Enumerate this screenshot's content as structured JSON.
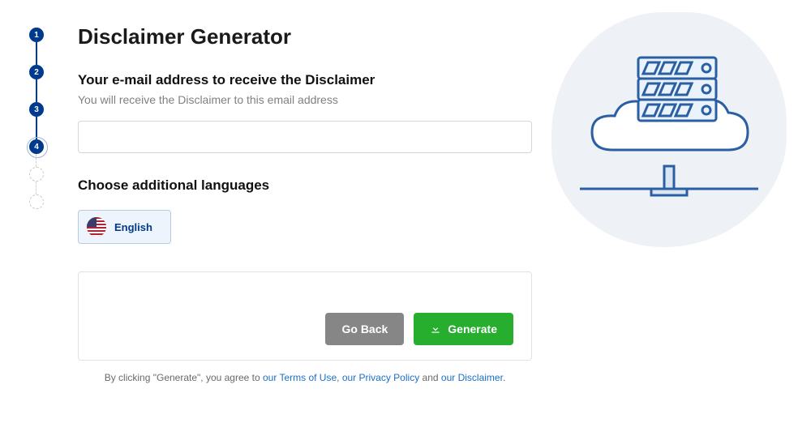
{
  "title": "Disclaimer Generator",
  "stepper": {
    "steps": [
      "1",
      "2",
      "3",
      "4"
    ],
    "current": 4,
    "extra_dashed": 2
  },
  "email_section": {
    "heading": "Your e-mail address to receive the Disclaimer",
    "hint": "You will receive the Disclaimer to this email address",
    "value": ""
  },
  "lang_section": {
    "heading": "Choose additional languages",
    "selected": "English"
  },
  "buttons": {
    "back": "Go Back",
    "generate": "Generate"
  },
  "footer": {
    "prefix": "By clicking \"Generate\", you agree to ",
    "terms": "our Terms of Use",
    "sep1": ", ",
    "privacy": "our Privacy Policy",
    "sep2": " and ",
    "disclaimer": "our Disclaimer",
    "suffix": "."
  },
  "icons": {
    "flag": "usa-flag-icon",
    "download": "download-icon",
    "illustration": "cloud-server-illustration"
  }
}
